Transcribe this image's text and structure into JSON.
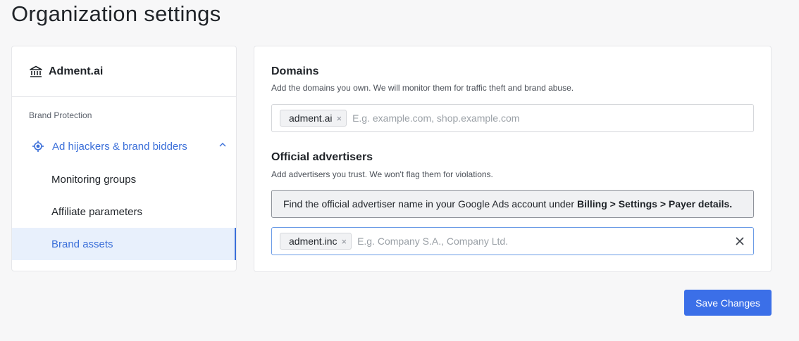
{
  "page": {
    "title": "Organization settings"
  },
  "sidebar": {
    "org_name": "Adment.ai",
    "section_label": "Brand Protection",
    "parent_item": {
      "label": "Ad hijackers & brand bidders",
      "expanded": true
    },
    "items": [
      {
        "label": "Monitoring groups",
        "active": false
      },
      {
        "label": "Affiliate parameters",
        "active": false
      },
      {
        "label": "Brand assets",
        "active": true
      }
    ]
  },
  "domains": {
    "title": "Domains",
    "description": "Add the domains you own. We will monitor them for traffic theft and brand abuse.",
    "tags": [
      "adment.ai"
    ],
    "placeholder": "E.g. example.com, shop.example.com"
  },
  "advertisers": {
    "title": "Official advertisers",
    "description": "Add advertisers you trust. We won't flag them for violations.",
    "info_text": "Find the official advertiser name in your Google Ads account under",
    "info_bold": "Billing > Settings > Payer details.",
    "tags": [
      "adment.inc"
    ],
    "placeholder": "E.g. Company S.A., Company Ltd."
  },
  "actions": {
    "save_label": "Save Changes"
  },
  "colors": {
    "accent": "#3b6fe8",
    "active_bg": "#e8f0fc",
    "link": "#3b6fd9"
  }
}
